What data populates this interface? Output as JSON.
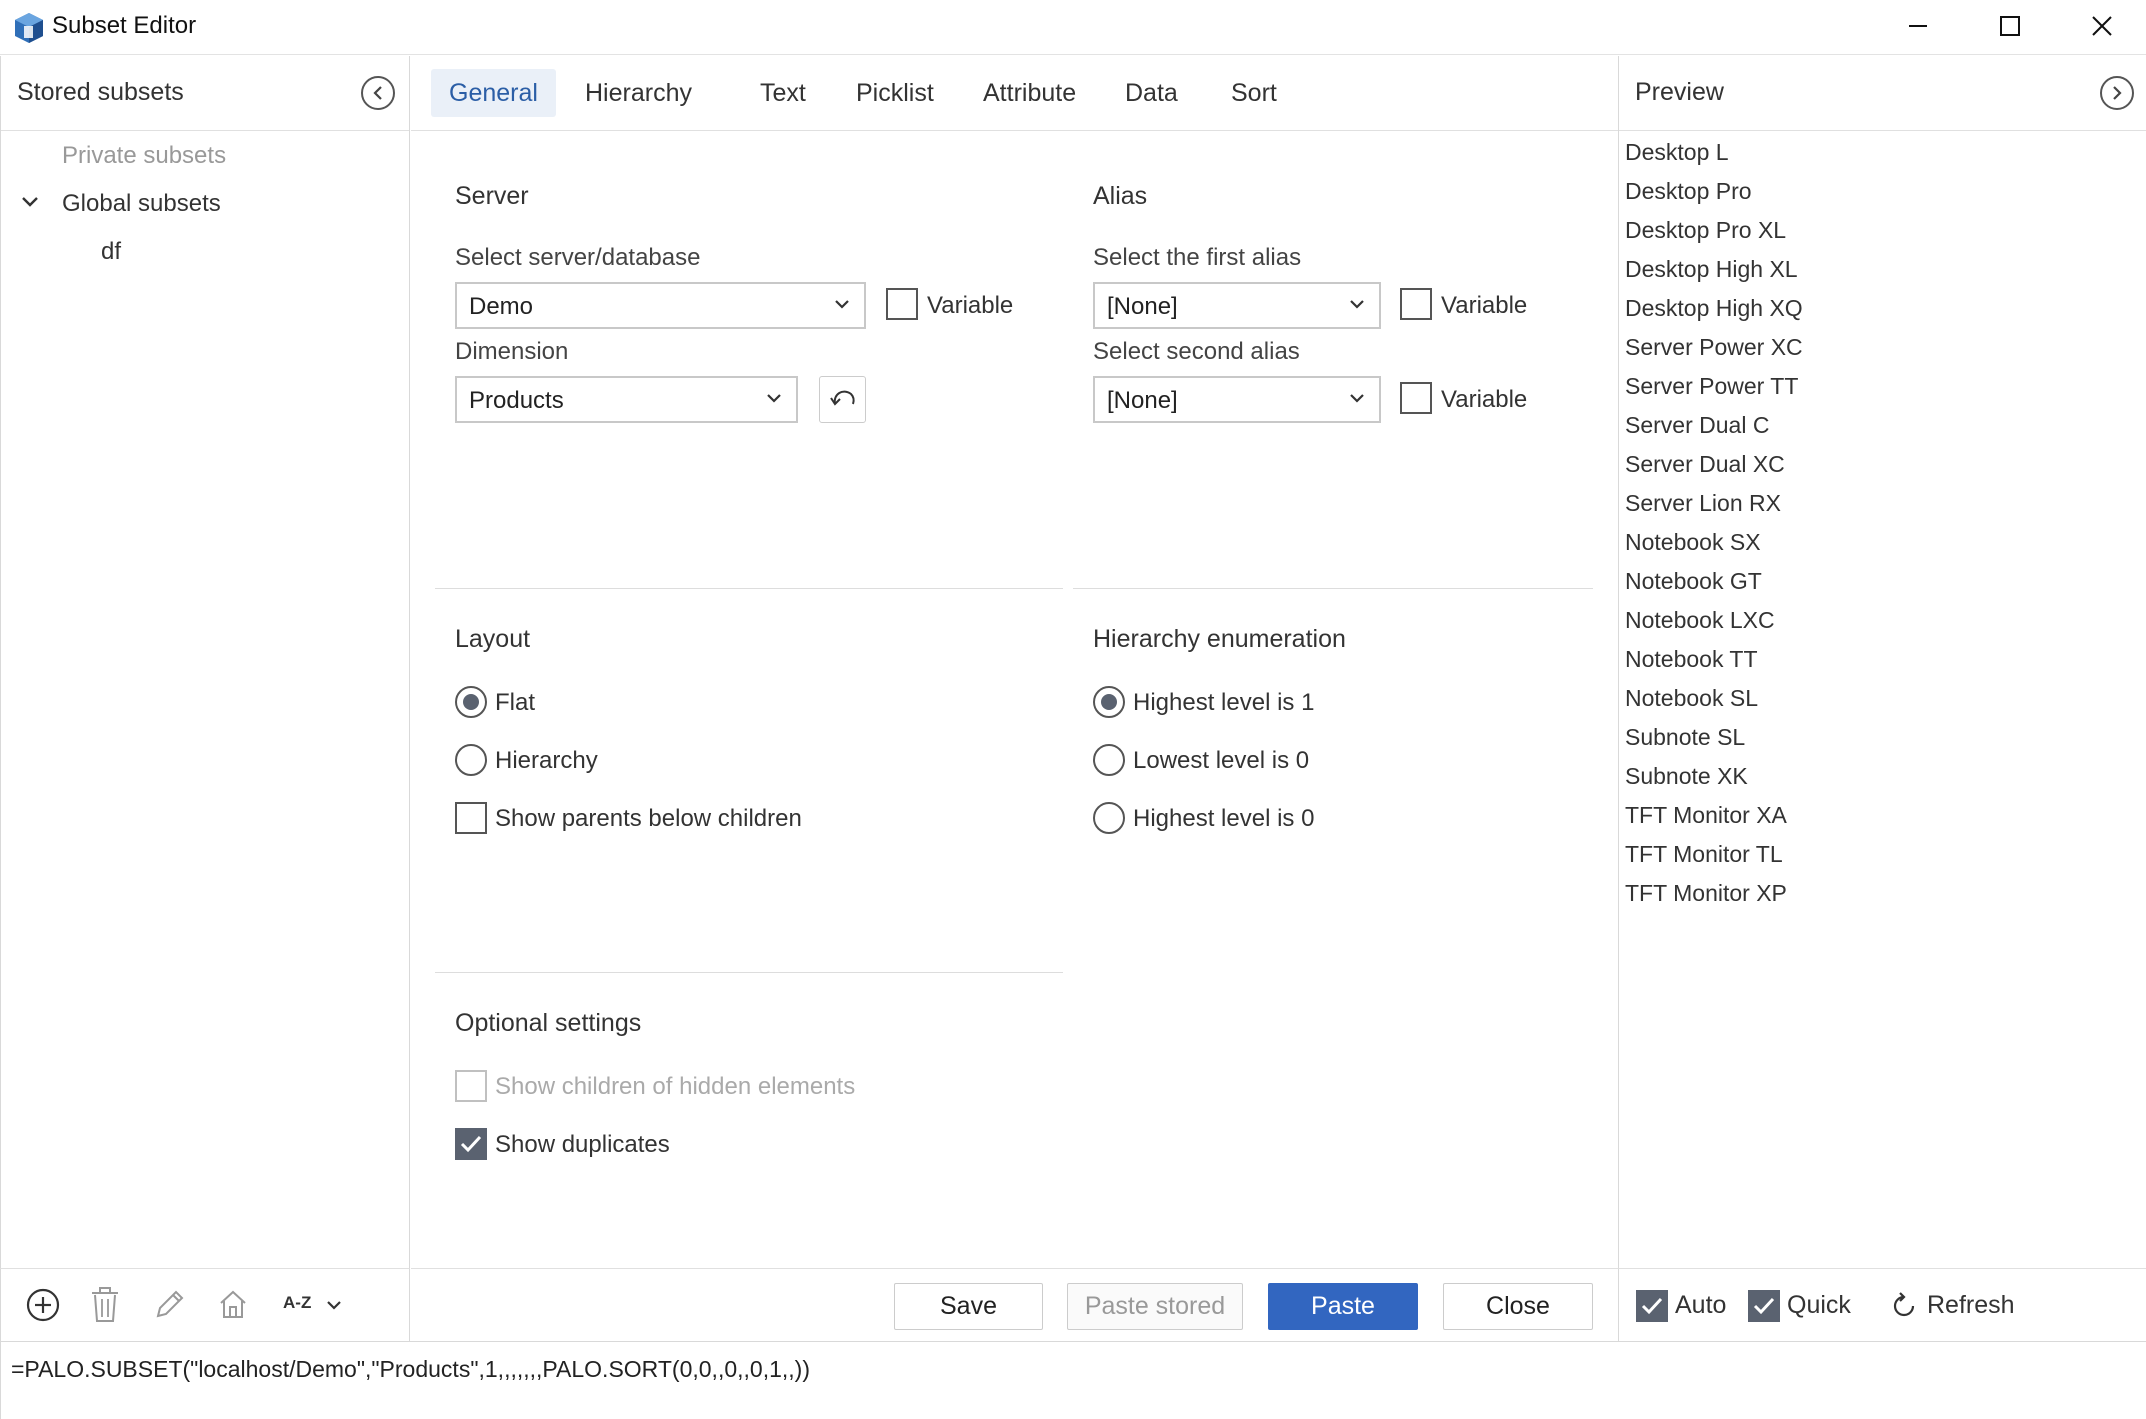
{
  "window": {
    "title": "Subset Editor",
    "icon": "cube-app-icon",
    "controls": [
      "minimize",
      "maximize",
      "close"
    ]
  },
  "left_panel": {
    "title": "Stored subsets",
    "collapse_icon": "chevron-left-circle-icon",
    "tree": {
      "private_label": "Private subsets",
      "global_label": "Global subsets",
      "global_expanded": true,
      "global_children": [
        "df"
      ]
    },
    "toolbar": {
      "icons": [
        "add-icon",
        "delete-icon",
        "edit-icon",
        "home-icon"
      ],
      "sort_label": "A-Z"
    }
  },
  "tabs": [
    {
      "label": "General",
      "active": true
    },
    {
      "label": "Hierarchy",
      "active": false
    },
    {
      "label": "Text",
      "active": false
    },
    {
      "label": "Picklist",
      "active": false
    },
    {
      "label": "Attribute",
      "active": false
    },
    {
      "label": "Data",
      "active": false
    },
    {
      "label": "Sort",
      "active": false
    }
  ],
  "general": {
    "server": {
      "title": "Server",
      "select_label": "Select server/database",
      "select_value": "Demo",
      "variable_label": "Variable",
      "variable_checked": false,
      "dimension_label": "Dimension",
      "dimension_value": "Products"
    },
    "alias": {
      "title": "Alias",
      "first_label": "Select the first alias",
      "first_value": "[None]",
      "first_variable_label": "Variable",
      "second_label": "Select second alias",
      "second_value": "[None]",
      "second_variable_label": "Variable"
    },
    "layout": {
      "title": "Layout",
      "flat_label": "Flat",
      "hierarchy_label": "Hierarchy",
      "selected": "Flat",
      "show_parents_label": "Show parents below children",
      "show_parents_checked": false
    },
    "hierarchy_enumeration": {
      "title": "Hierarchy enumeration",
      "options": [
        "Highest level is 1",
        "Lowest level is 0",
        "Highest level is 0"
      ],
      "selected": "Highest level is 1"
    },
    "optional": {
      "title": "Optional settings",
      "show_children_hidden_label": "Show children of hidden elements",
      "show_children_hidden_checked": false,
      "show_children_hidden_disabled": true,
      "show_duplicates_label": "Show duplicates",
      "show_duplicates_checked": true
    }
  },
  "buttons": {
    "save": "Save",
    "paste_stored": "Paste stored",
    "paste": "Paste",
    "close": "Close"
  },
  "preview": {
    "title": "Preview",
    "expand_icon": "chevron-right-circle-icon",
    "items": [
      "Desktop L",
      "Desktop Pro",
      "Desktop Pro XL",
      "Desktop High XL",
      "Desktop High XQ",
      "Server Power XC",
      "Server Power TT",
      "Server Dual C",
      "Server Dual XC",
      "Server Lion RX",
      "Notebook SX",
      "Notebook GT",
      "Notebook LXC",
      "Notebook TT",
      "Notebook SL",
      "Subnote SL",
      "Subnote XK",
      "TFT Monitor XA",
      "TFT Monitor TL",
      "TFT Monitor XP"
    ],
    "auto_label": "Auto",
    "auto_checked": true,
    "quick_label": "Quick",
    "quick_checked": true,
    "refresh_label": "Refresh"
  },
  "formula": "=PALO.SUBSET(\"localhost/Demo\",\"Products\",1,,,,,,,PALO.SORT(0,0,,0,,0,1,,))",
  "colors": {
    "accent": "#3266c0",
    "active_tab_bg": "#eaf0f8",
    "checked_fill": "#5a6270"
  }
}
